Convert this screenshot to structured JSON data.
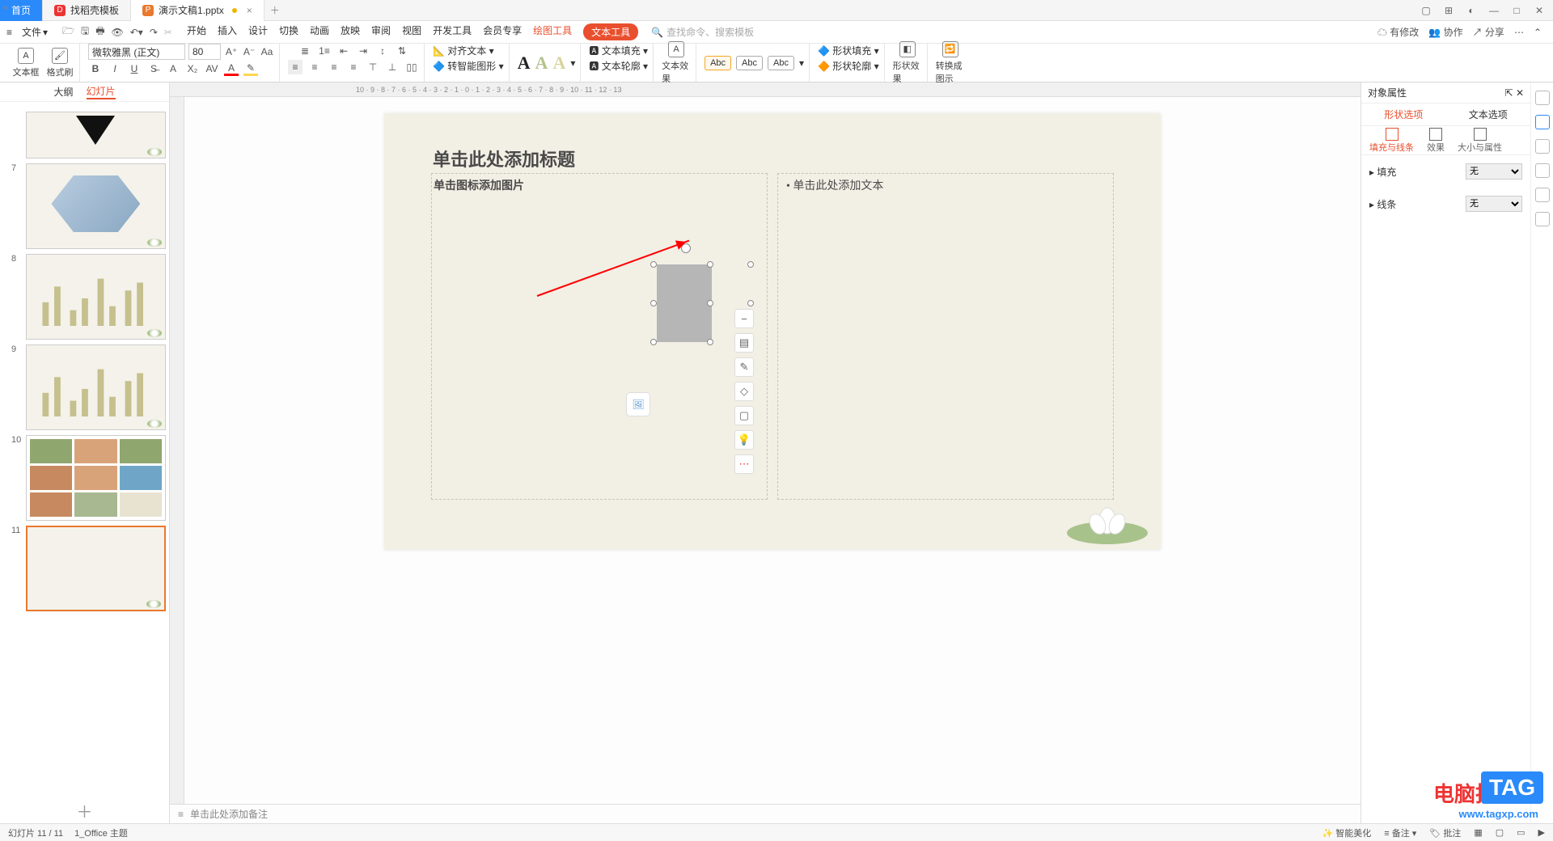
{
  "tabs": {
    "home": "首页",
    "t1": "找稻壳模板",
    "t2": "演示文稿1.pptx"
  },
  "menu": {
    "file": "文件",
    "start": "开始",
    "insert": "插入",
    "design": "设计",
    "transition": "切换",
    "animation": "动画",
    "slideshow": "放映",
    "review": "审阅",
    "view": "视图",
    "devtools": "开发工具",
    "member": "会员专享",
    "drawtools": "绘图工具",
    "texttools": "文本工具"
  },
  "search_ph": "查找命令、搜索模板",
  "top_right": {
    "changes": "有修改",
    "coop": "协作",
    "share": "分享"
  },
  "ribbon": {
    "textbox": "文本框",
    "fmtbrush": "格式刷",
    "font": "微软雅黑 (正文)",
    "size": "80",
    "aligntext": "对齐文本",
    "smartshape": "转智能图形",
    "textfill": "文本填充",
    "textoutline": "文本轮廓",
    "texteffect": "文本效果",
    "abc": "Abc",
    "shapefill": "形状填充",
    "shapeoutline": "形状轮廓",
    "shapeeffect": "形状效果",
    "tosmartart": "转换成图示"
  },
  "left_tabs": {
    "outline": "大纲",
    "slides": "幻灯片"
  },
  "thumb_nums": [
    "",
    "7",
    "8",
    "9",
    "10",
    "11"
  ],
  "slide": {
    "title": "单击此处添加标题",
    "picprompt": "单击图标添加图片",
    "textprompt": "单击此处添加文本"
  },
  "notes_ph": "单击此处添加备注",
  "props": {
    "title": "对象属性",
    "tab_shape": "形状选项",
    "tab_text": "文本选项",
    "sub_fill": "填充与线条",
    "sub_effect": "效果",
    "sub_size": "大小与属性",
    "fill": "填充",
    "line": "线条",
    "none": "无"
  },
  "status": {
    "slideno": "幻灯片 11 / 11",
    "theme": "1_Office 主题",
    "beautify": "智能美化",
    "notes": "备注",
    "approve": "批注"
  },
  "watermark": {
    "l1": "电脑技术网",
    "l2": "www.tagxp.com",
    "tag": "TAG"
  }
}
